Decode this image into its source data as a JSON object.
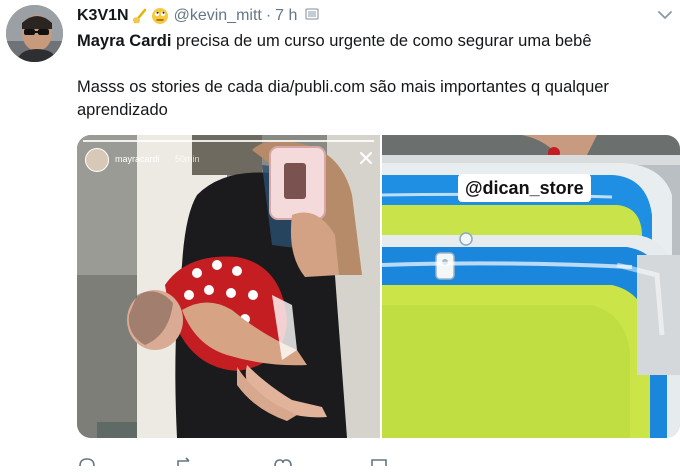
{
  "tweet": {
    "display_name": "K3V1N",
    "emojis": [
      "writing-hand-emoji",
      "face-with-rolling-eyes-emoji"
    ],
    "handle": "@kevin_mitt",
    "separator": "·",
    "time": "7 h",
    "text_mention": "Mayra Cardi",
    "text_line1_rest": " precisa de um curso urgente de como segurar uma bebê",
    "text_paragraph2": "Masss os stories de cada dia/publi.com são mais importantes q qualquer aprendizado"
  },
  "media": {
    "story": {
      "username": "mayracardi",
      "time": "50min"
    },
    "sticker_text": "@dican_store"
  },
  "icons": {
    "menu": "chevron-down-icon",
    "flag": "flag-icon",
    "close": "close-icon",
    "reply": "reply-icon",
    "retweet": "retweet-icon",
    "like": "heart-icon",
    "share": "share-icon"
  },
  "colors": {
    "text": "#14171a",
    "secondary": "#657786",
    "pool_blue": "#1f8fe0",
    "pool_green": "#c9e24a"
  }
}
